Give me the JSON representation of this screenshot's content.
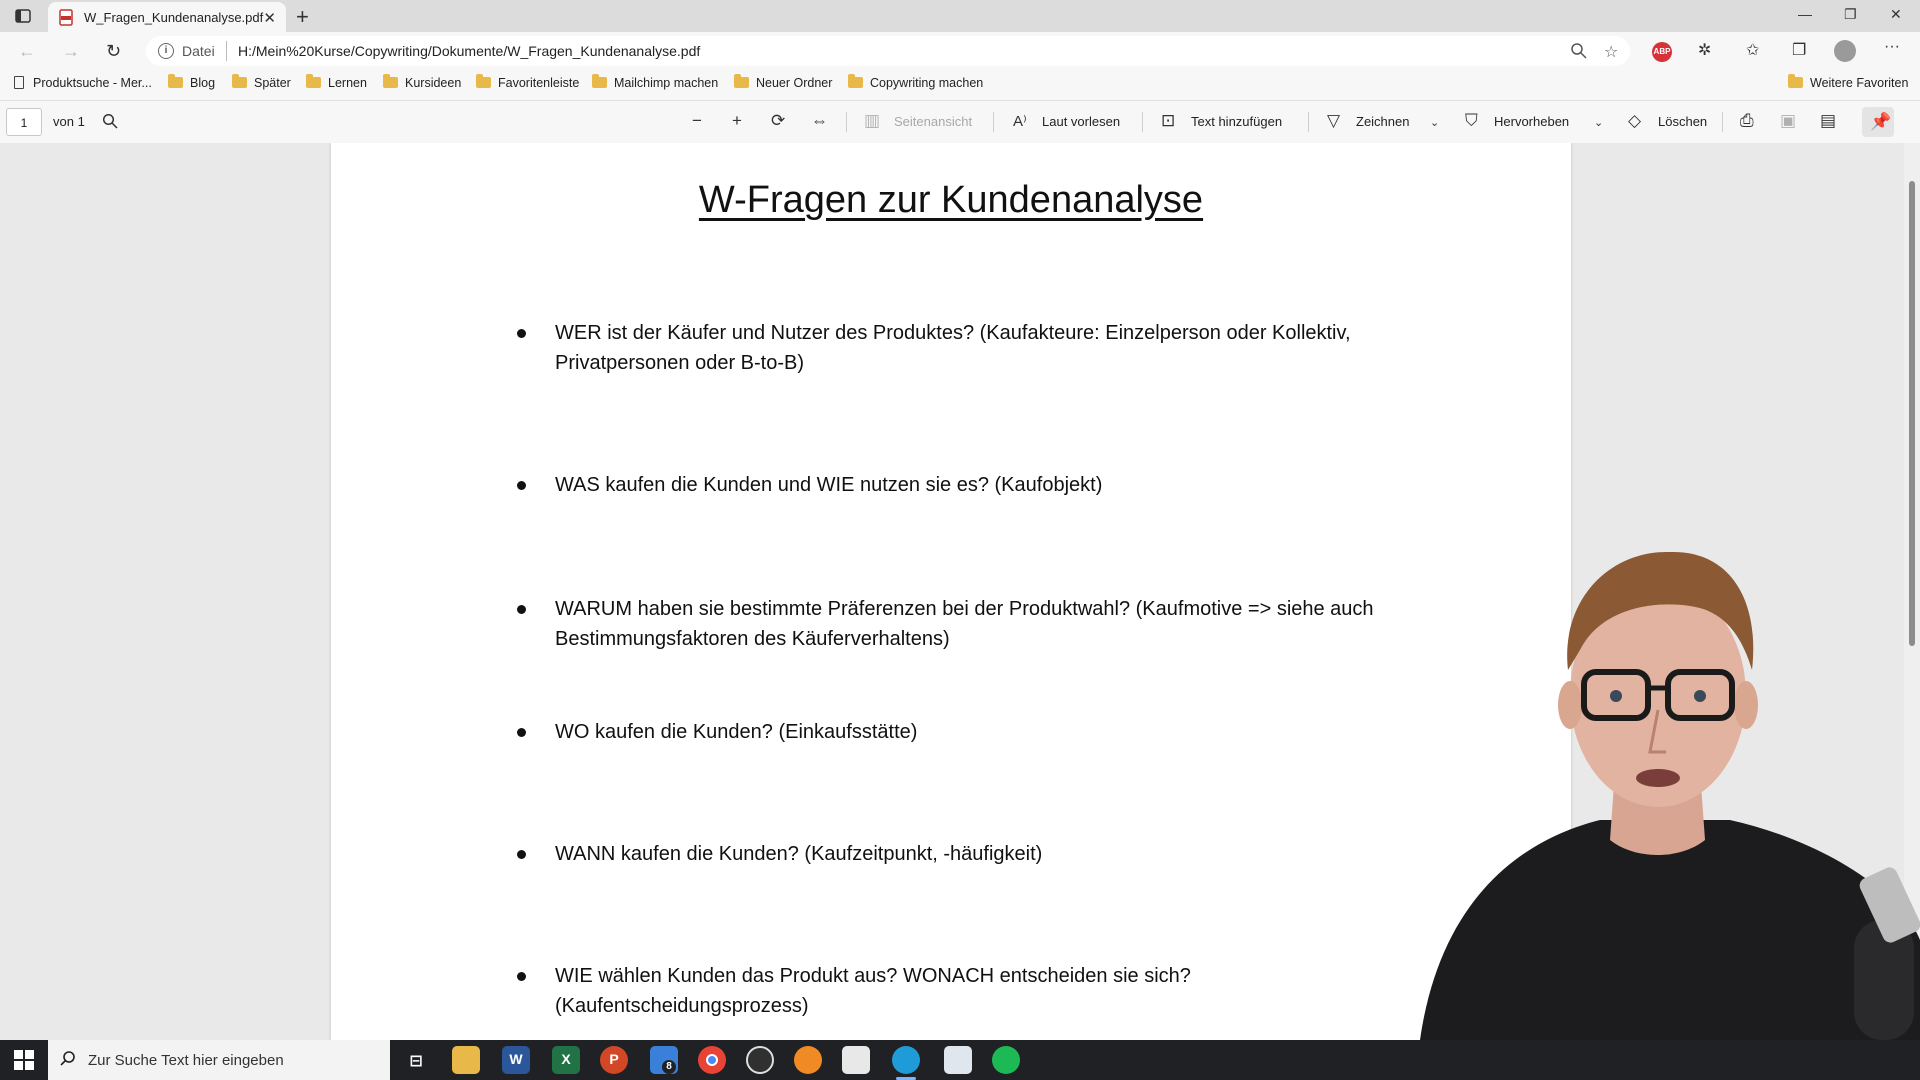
{
  "browser": {
    "tab_title": "W_Fragen_Kundenanalyse.pdf",
    "new_tab_symbol": "+",
    "address": {
      "scheme_label": "Datei",
      "url": "H:/Mein%20Kurse/Copywriting/Dokumente/W_Fragen_Kundenanalyse.pdf"
    },
    "window_controls": [
      "—",
      "❐",
      "✕"
    ]
  },
  "favorites": {
    "items": [
      {
        "label": "Produktsuche - Mer...",
        "icon": "page-icon"
      },
      {
        "label": "Blog",
        "icon": "folder-icon"
      },
      {
        "label": "Später",
        "icon": "folder-icon"
      },
      {
        "label": "Lernen",
        "icon": "folder-icon"
      },
      {
        "label": "Kursideen",
        "icon": "folder-icon"
      },
      {
        "label": "Favoritenleiste",
        "icon": "folder-icon"
      },
      {
        "label": "Mailchimp machen",
        "icon": "folder-icon"
      },
      {
        "label": "Neuer Ordner",
        "icon": "folder-icon"
      },
      {
        "label": "Copywriting machen",
        "icon": "folder-icon"
      }
    ],
    "other": "Weitere Favoriten"
  },
  "pdf_toolbar": {
    "page_number": "1",
    "page_of": "von 1",
    "page_view": "Seitenansicht",
    "read_aloud": "Laut vorlesen",
    "add_text": "Text hinzufügen",
    "draw": "Zeichnen",
    "highlight": "Hervorheben",
    "erase": "Löschen"
  },
  "document": {
    "title": "W-Fragen zur Kundenanalyse",
    "bullets": [
      {
        "line1": "WER ist der Käufer und Nutzer des Produktes? (Kaufakteure: Einzelperson oder Kollektiv,",
        "line2": "Privatpersonen oder B-to-B)"
      },
      {
        "line1": "WAS kaufen die Kunden und WIE nutzen sie es? (Kaufobjekt)",
        "line2": ""
      },
      {
        "line1": "WARUM haben sie bestimmte Präferenzen bei der Produktwahl? (Kaufmotive => siehe auch",
        "line2": "Bestimmungsfaktoren des Käuferverhaltens)"
      },
      {
        "line1": "WO kaufen die Kunden? (Einkaufsstätte)",
        "line2": ""
      },
      {
        "line1": "WANN kaufen die Kunden? (Kaufzeitpunkt, -häufigkeit)",
        "line2": ""
      },
      {
        "line1": "WIE wählen Kunden das Produkt aus? WONACH entscheiden sie sich?",
        "line2": "(Kaufentscheidungsprozess)"
      }
    ]
  },
  "taskbar": {
    "search_placeholder": "Zur Suche Text hier eingeben",
    "mail_badge": "8",
    "apps": [
      "task-view",
      "file-explorer",
      "word",
      "excel",
      "powerpoint",
      "mail",
      "chrome",
      "obs",
      "app-orange",
      "app-pen",
      "edge",
      "app-notes",
      "spotify"
    ]
  }
}
